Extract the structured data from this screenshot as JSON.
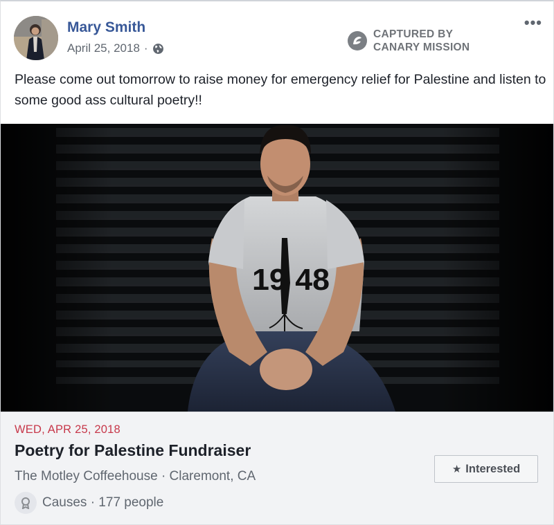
{
  "post": {
    "author_name": "Mary Smith",
    "date": "April 25, 2018",
    "separator": "·",
    "privacy_icon": "globe-icon",
    "more_icon": "•••",
    "text": "Please come out tomorrow to raise money for emergency relief for Palestine and listen to some good ass cultural poetry!!"
  },
  "watermark": {
    "line1": "CAPTURED BY",
    "line2": "CANARY MISSION"
  },
  "photo": {
    "shirt_text": "19 48"
  },
  "event": {
    "date": "WED, APR 25, 2018",
    "title": "Poetry for Palestine Fundraiser",
    "venue": "The Motley Coffeehouse · Claremont, CA",
    "category": "Causes · 177 people",
    "interested_label": "Interested",
    "interested_icon": "star-icon"
  },
  "colors": {
    "author_link": "#385898",
    "event_date": "#c7384a",
    "secondary_text": "#606770",
    "footer_bg": "#f2f3f5"
  }
}
